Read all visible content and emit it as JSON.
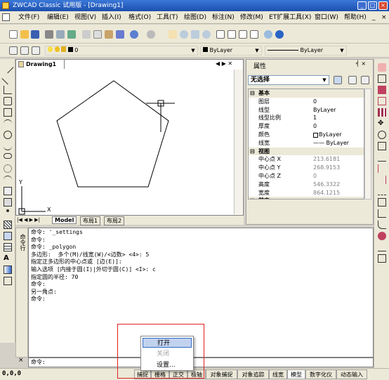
{
  "window": {
    "title": "ZWCAD Classic 试用版 - [Drawing1]",
    "controls": [
      "_",
      "□",
      "×"
    ]
  },
  "menubar": {
    "items": [
      "文件(F)",
      "编辑(E)",
      "视图(V)",
      "插入(I)",
      "格式(O)",
      "工具(T)",
      "绘图(D)",
      "标注(N)",
      "修改(M)",
      "ET扩展工具(X)",
      "窗口(W)",
      "帮助(H)"
    ],
    "doc_controls": [
      "_",
      "×"
    ]
  },
  "toolbar2": {
    "layer_value": "0",
    "color_value": "ByLayer",
    "linetype_value": "ByLayer"
  },
  "drawing": {
    "tab_label": "Drawing1",
    "axis_x": "X",
    "axis_y": "Y"
  },
  "layout_tabs": [
    "Model",
    "布局1",
    "布局2"
  ],
  "properties": {
    "title": "属性",
    "selection": "无选择",
    "sections": [
      "基本",
      "视图",
      "其它"
    ],
    "rows": [
      {
        "name": "图层",
        "value": "0"
      },
      {
        "name": "线型",
        "value": "ByLayer"
      },
      {
        "name": "线型比例",
        "value": "1"
      },
      {
        "name": "厚度",
        "value": "0"
      },
      {
        "name": "颜色",
        "value": "ByLayer"
      },
      {
        "name": "线宽",
        "value": "—— ByLayer"
      },
      {
        "name": "中心点 X",
        "value": "213.6181"
      },
      {
        "name": "中心点 Y",
        "value": "268.9153"
      },
      {
        "name": "中心点 Z",
        "value": "0"
      },
      {
        "name": "高度",
        "value": "546.3322"
      },
      {
        "name": "宽度",
        "value": "864.1215"
      }
    ]
  },
  "command": {
    "side_label": "命令行",
    "lines": [
      "命令: '_settings",
      "命令:",
      "命令: _polygon",
      "多边形:  多个(M)/线宽(W)/<边数> <4>: 5",
      "指定正多边形的中心点或 [边(E)]:",
      "输入选项 [内接于圆(I)|外切于圆(C)] <I>: c",
      "指定圆的半径: 70",
      "命令:",
      "另一角点:",
      "命令:"
    ],
    "prompt": "命令:"
  },
  "status": {
    "coords": "0,0,0",
    "buttons": [
      "捕捉",
      "栅格",
      "正交",
      "极轴",
      "对象捕捉",
      "对象追踪",
      "线宽",
      "模型",
      "数字化仪",
      "动态输入"
    ]
  },
  "context_menu": {
    "items": [
      "打开",
      "关闭",
      "设置..."
    ]
  },
  "colors": {
    "title_bar": "#2a63c6",
    "highlight_box": "#e02020",
    "menu_hover": "#c1d2ee"
  }
}
